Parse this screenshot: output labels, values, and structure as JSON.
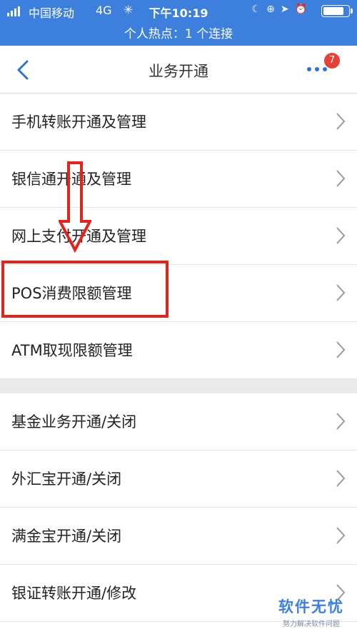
{
  "status_bar": {
    "carrier": "中国移动",
    "network": "4G",
    "loading_glyph": "✳",
    "time": "下午10:19",
    "icons": [
      "moon-icon",
      "lock-rotation-icon",
      "location-icon",
      "alarm-icon"
    ],
    "hotspot_text": "个人热点：1 个连接",
    "background_color": "#3d7fdc"
  },
  "nav": {
    "title": "业务开通",
    "badge_count": "7",
    "accent_color": "#2f72d6",
    "badge_color": "#e64137"
  },
  "section1": {
    "items": [
      {
        "label": "手机转账开通及管理"
      },
      {
        "label": "银信通开通及管理"
      },
      {
        "label": "网上支付开通及管理"
      },
      {
        "label": "POS消费限额管理"
      },
      {
        "label": "ATM取现限额管理"
      }
    ]
  },
  "section2": {
    "items": [
      {
        "label": "基金业务开通/关闭"
      },
      {
        "label": "外汇宝开通/关闭"
      },
      {
        "label": "满金宝开通/关闭"
      },
      {
        "label": "银证转账开通/修改"
      }
    ]
  },
  "annotation": {
    "highlight_color": "#e2241a"
  },
  "watermark": {
    "title": "软件无忧",
    "subtitle": "努力解决软件问题"
  }
}
